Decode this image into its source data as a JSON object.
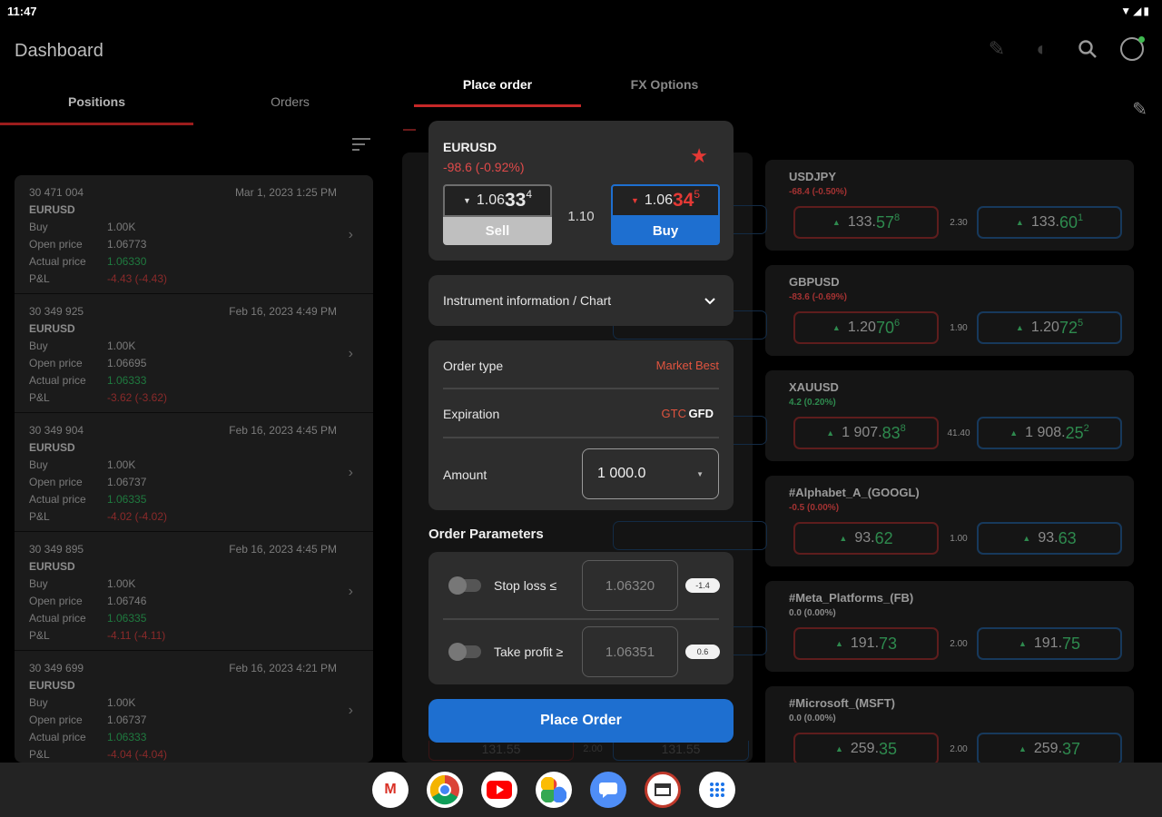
{
  "status": {
    "time": "11:47"
  },
  "appbar": {
    "title": "Dashboard"
  },
  "left_tabs": [
    "Positions",
    "Orders"
  ],
  "positions": [
    {
      "id": "30 471 004",
      "date": "Mar 1, 2023 1:25 PM",
      "symbol": "EURUSD",
      "side": "Buy",
      "size": "1.00K",
      "open_price": "1.06773",
      "actual_price": "1.06330",
      "pnl": "-4.43 (-4.43)"
    },
    {
      "id": "30 349 925",
      "date": "Feb 16, 2023 4:49 PM",
      "symbol": "EURUSD",
      "side": "Buy",
      "size": "1.00K",
      "open_price": "1.06695",
      "actual_price": "1.06333",
      "pnl": "-3.62 (-3.62)"
    },
    {
      "id": "30 349 904",
      "date": "Feb 16, 2023 4:45 PM",
      "symbol": "EURUSD",
      "side": "Buy",
      "size": "1.00K",
      "open_price": "1.06737",
      "actual_price": "1.06335",
      "pnl": "-4.02 (-4.02)"
    },
    {
      "id": "30 349 895",
      "date": "Feb 16, 2023 4:45 PM",
      "symbol": "EURUSD",
      "side": "Buy",
      "size": "1.00K",
      "open_price": "1.06746",
      "actual_price": "1.06335",
      "pnl": "-4.11 (-4.11)"
    },
    {
      "id": "30 349 699",
      "date": "Feb 16, 2023 4:21 PM",
      "symbol": "EURUSD",
      "side": "Buy",
      "size": "1.00K",
      "open_price": "1.06737",
      "actual_price": "1.06333",
      "pnl": "-4.04 (-4.04)"
    }
  ],
  "position_labels": {
    "open_price": "Open price",
    "actual_price": "Actual price",
    "pnl": "P&L"
  },
  "center_tabs": [
    "Place order",
    "FX Options"
  ],
  "order": {
    "symbol": "EURUSD",
    "change": "-98.6 (-0.92%)",
    "sell": {
      "pre": "1.06",
      "big": "33",
      "sup": "4",
      "label": "Sell"
    },
    "buy": {
      "pre": "1.06",
      "big": "34",
      "sup": "5",
      "label": "Buy"
    },
    "spread": "1.10",
    "info_label": "Instrument information / Chart",
    "order_type_label": "Order type",
    "order_type_value": "Market Best",
    "expiration_label": "Expiration",
    "expiration_gtc": "GTC",
    "expiration_gfd": "GFD",
    "amount_label": "Amount",
    "amount_value": "1 000.0",
    "params_title": "Order Parameters",
    "stop_loss_label": "Stop loss ≤",
    "stop_loss_value": "1.06320",
    "stop_loss_pips": "-1.4",
    "take_profit_label": "Take profit ≥",
    "take_profit_value": "1.06351",
    "take_profit_pips": "0.6",
    "place_label": "Place Order"
  },
  "watchlist": [
    {
      "name": "USDJPY",
      "change": "-68.4 (-0.50%)",
      "dir": "red",
      "sell": {
        "pre": "133.",
        "big": "57",
        "sup": "8"
      },
      "spread": "2.30",
      "buy": {
        "pre": "133.",
        "big": "60",
        "sup": "1"
      }
    },
    {
      "name": "GBPUSD",
      "change": "-83.6 (-0.69%)",
      "dir": "red",
      "sell": {
        "pre": "1.20",
        "big": "70",
        "sup": "6"
      },
      "spread": "1.90",
      "buy": {
        "pre": "1.20",
        "big": "72",
        "sup": "5"
      }
    },
    {
      "name": "XAUUSD",
      "change": "4.2 (0.20%)",
      "dir": "green",
      "sell": {
        "pre": "1 907.",
        "big": "83",
        "sup": "8"
      },
      "spread": "41.40",
      "buy": {
        "pre": "1 908.",
        "big": "25",
        "sup": "2"
      }
    },
    {
      "name": "#Alphabet_A_(GOOGL)",
      "change": "-0.5 (0.00%)",
      "dir": "red",
      "sell": {
        "pre": "93.",
        "big": "62",
        "sup": ""
      },
      "spread": "1.00",
      "buy": {
        "pre": "93.",
        "big": "63",
        "sup": ""
      }
    },
    {
      "name": "#Meta_Platforms_(FB)",
      "change": "0.0 (0.00%)",
      "dir": "grey",
      "sell": {
        "pre": "191.",
        "big": "73",
        "sup": ""
      },
      "spread": "2.00",
      "buy": {
        "pre": "191.",
        "big": "75",
        "sup": ""
      }
    },
    {
      "name": "#Microsoft_(MSFT)",
      "change": "0.0 (0.00%)",
      "dir": "grey",
      "sell": {
        "pre": "259.",
        "big": "35",
        "sup": ""
      },
      "spread": "2.00",
      "buy": {
        "pre": "259.",
        "big": "37",
        "sup": ""
      }
    }
  ],
  "ghost_row": {
    "left": "131.55",
    "mid": "2.00",
    "right": "131.55"
  },
  "dock_apps": [
    "gmail-icon",
    "chrome-icon",
    "youtube-icon",
    "photos-icon",
    "messages-icon",
    "app-icon",
    "app-drawer-icon"
  ]
}
